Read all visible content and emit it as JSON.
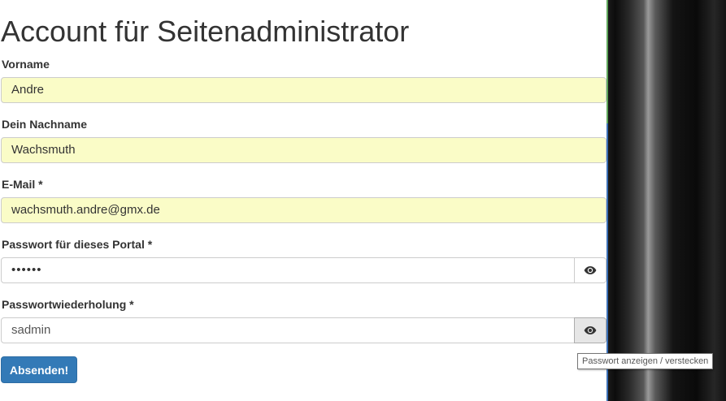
{
  "page_title": "Account für Seitenadministrator",
  "fields": {
    "vorname": {
      "label": "Vorname",
      "value": "Andre"
    },
    "nachname": {
      "label": "Dein Nachname",
      "value": "Wachsmuth"
    },
    "email": {
      "label": "E-Mail *",
      "value": "wachsmuth.andre@gmx.de"
    },
    "passwort": {
      "label": "Passwort für dieses Portal *",
      "value": "••••••"
    },
    "passwort_wdh": {
      "label": "Passwortwiederholung *",
      "value": "sadmin"
    }
  },
  "submit_label": "Absenden!",
  "tooltip": "Passwort anzeigen / verstecken",
  "icons": {
    "toggle_password": "eye-icon"
  },
  "colors": {
    "autofill_bg": "#fafcc7",
    "primary": "#337ab7"
  }
}
